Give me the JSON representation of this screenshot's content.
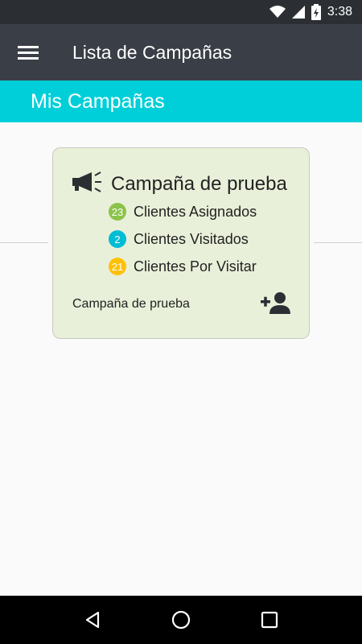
{
  "status_bar": {
    "time": "3:38",
    "icons": [
      "wifi-icon",
      "signal-icon",
      "battery-charging-icon"
    ]
  },
  "app_bar": {
    "menu_icon": "hamburger-menu-icon",
    "title": "Lista de Campañas"
  },
  "section": {
    "title": "Mis Campañas"
  },
  "campaign_card": {
    "icon": "megaphone-icon",
    "title": "Campaña de prueba",
    "stats": [
      {
        "count": "23",
        "label": "Clientes Asignados",
        "color": "#8bc34a"
      },
      {
        "count": "2",
        "label": "Clientes Visitados",
        "color": "#00bcd4"
      },
      {
        "count": "21",
        "label": "Clientes Por Visitar",
        "color": "#ffc107"
      }
    ],
    "footer_text": "Campaña de prueba",
    "add_icon": "add-person-icon"
  },
  "nav_bar": {
    "buttons": [
      "back-icon",
      "home-icon",
      "recents-icon"
    ]
  },
  "colors": {
    "status_bar": "#2b2f33",
    "app_bar": "#3a3f47",
    "section_bar": "#00cfd9",
    "card_background": "#e9f0d9",
    "nav_bar": "#000000"
  }
}
